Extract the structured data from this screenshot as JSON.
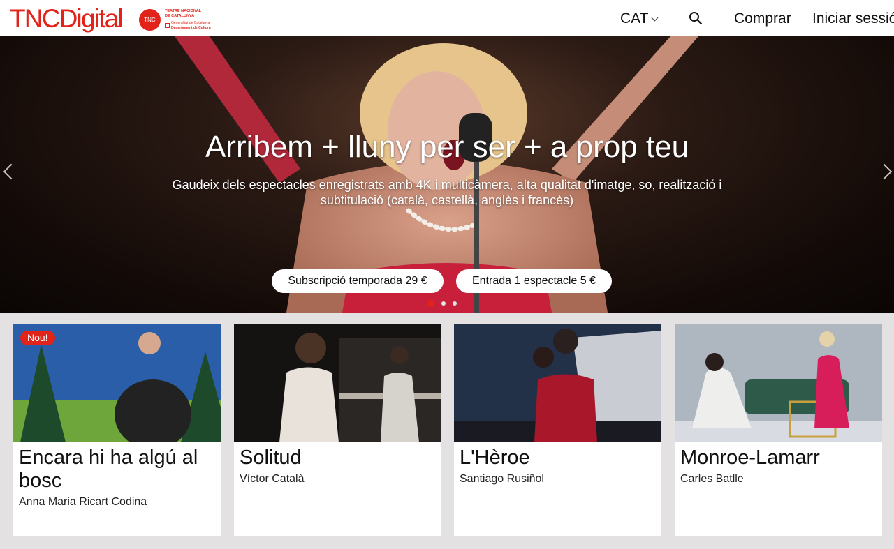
{
  "header": {
    "logo_text": "TNCDigital",
    "tnc_badge": "TNC",
    "tnc_name_line1": "TEATRE NACIONAL",
    "tnc_name_line2": "DE CATALUNYA",
    "gen_line1": "Generalitat de Catalunya",
    "gen_line2": "Departament de Cultura",
    "language": "CAT",
    "buy_label": "Comprar",
    "login_label": "Iniciar sessió"
  },
  "hero": {
    "title": "Arribem + lluny per ser + a prop teu",
    "subtitle": "Gaudeix dels espectacles enregistrats amb 4K i multicàmera, alta qualitat d'imatge, so, realització i subtitulació (català, castellà, anglès i francès)",
    "subscription_button": "Subscripció temporada 29 €",
    "ticket_button": "Entrada 1 espectacle 5 €",
    "slide_count": 3,
    "active_slide": 1
  },
  "cards": [
    {
      "badge": "Nou!",
      "title": "Encara hi ha algú al bosc",
      "author": "Anna Maria Ricart Codina"
    },
    {
      "title": "Solitud",
      "author": "Víctor Català"
    },
    {
      "title": "L'Hèroe",
      "author": "Santiago Rusiñol"
    },
    {
      "title": "Monroe-Lamarr",
      "author": "Carles Batlle"
    }
  ],
  "colors": {
    "brand": "#e2231a",
    "page_bg": "#e3e1e2"
  }
}
